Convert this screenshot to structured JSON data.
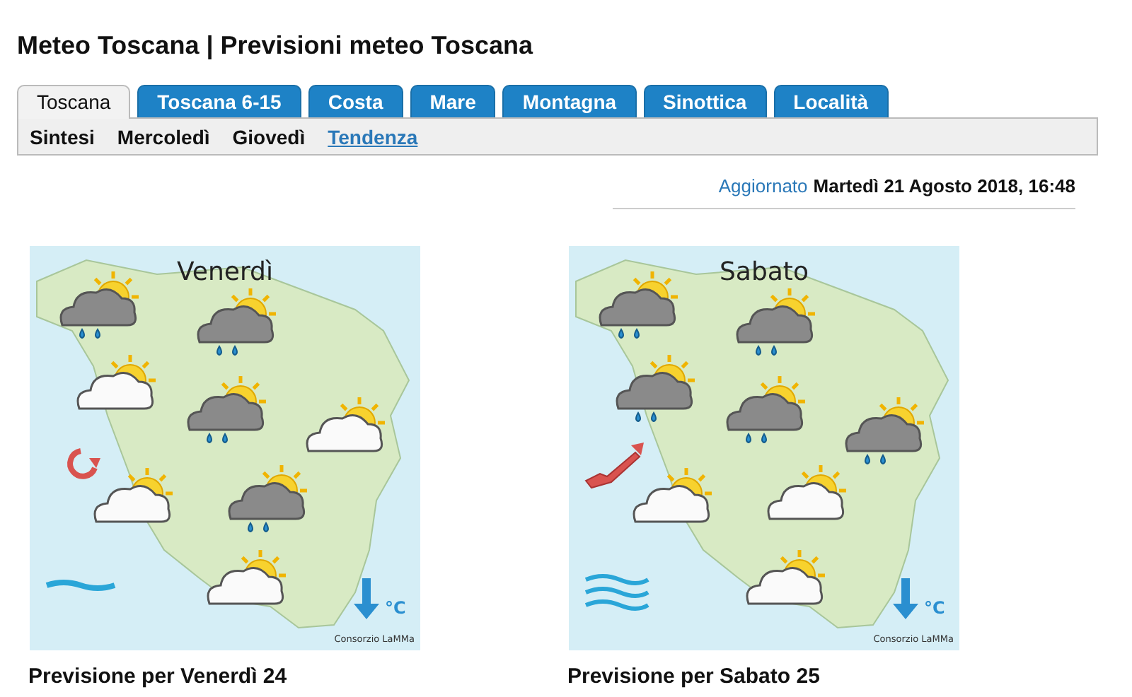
{
  "title": "Meteo Toscana | Previsioni meteo Toscana",
  "tabs": [
    {
      "label": "Toscana",
      "selected": true
    },
    {
      "label": "Toscana 6-15",
      "selected": false
    },
    {
      "label": "Costa",
      "selected": false
    },
    {
      "label": "Mare",
      "selected": false
    },
    {
      "label": "Montagna",
      "selected": false
    },
    {
      "label": "Sinottica",
      "selected": false
    },
    {
      "label": "Località",
      "selected": false
    }
  ],
  "subtabs": [
    {
      "label": "Sintesi",
      "selected": false
    },
    {
      "label": "Mercoledì",
      "selected": false
    },
    {
      "label": "Giovedì",
      "selected": false
    },
    {
      "label": "Tendenza",
      "selected": true
    }
  ],
  "updated": {
    "label": "Aggiornato",
    "value": "Martedì 21 Agosto 2018, 16:48"
  },
  "forecasts": [
    {
      "day": "Venerdì",
      "caption": "Previsione per Venerdì 24",
      "symbols": [
        {
          "kind": "curved"
        },
        {
          "kind": "wave"
        },
        {
          "kind": "down"
        }
      ],
      "unit": "°C",
      "credit": "Consorzio LaMMa",
      "icons": [
        {
          "kind": "rain"
        },
        {
          "kind": "rain"
        },
        {
          "kind": "cloudy"
        },
        {
          "kind": "rain"
        },
        {
          "kind": "cloudy"
        },
        {
          "kind": "cloudy"
        },
        {
          "kind": "rain"
        },
        {
          "kind": "cloudy"
        }
      ]
    },
    {
      "day": "Sabato",
      "caption": "Previsione per Sabato 25",
      "symbols": [
        {
          "kind": "arrow"
        },
        {
          "kind": "waves"
        },
        {
          "kind": "down"
        }
      ],
      "unit": "°C",
      "credit": "Consorzio LaMMa",
      "icons": [
        {
          "kind": "rain"
        },
        {
          "kind": "rain"
        },
        {
          "kind": "rain"
        },
        {
          "kind": "rain"
        },
        {
          "kind": "rain"
        },
        {
          "kind": "cloudy"
        },
        {
          "kind": "cloudy"
        },
        {
          "kind": "cloudy"
        }
      ]
    }
  ]
}
